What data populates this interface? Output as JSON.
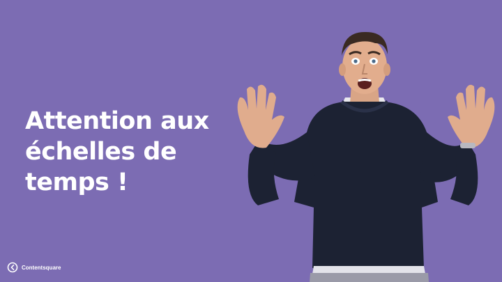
{
  "headline": {
    "line1": "Attention aux",
    "line2": "échelles de",
    "line3": "temps !"
  },
  "brand": {
    "name": "Contentsquare"
  },
  "colors": {
    "background": "#7c6cb3",
    "text": "#ffffff",
    "sweater": "#1c2233"
  },
  "icons": [
    "contentsquare-logo-icon"
  ]
}
